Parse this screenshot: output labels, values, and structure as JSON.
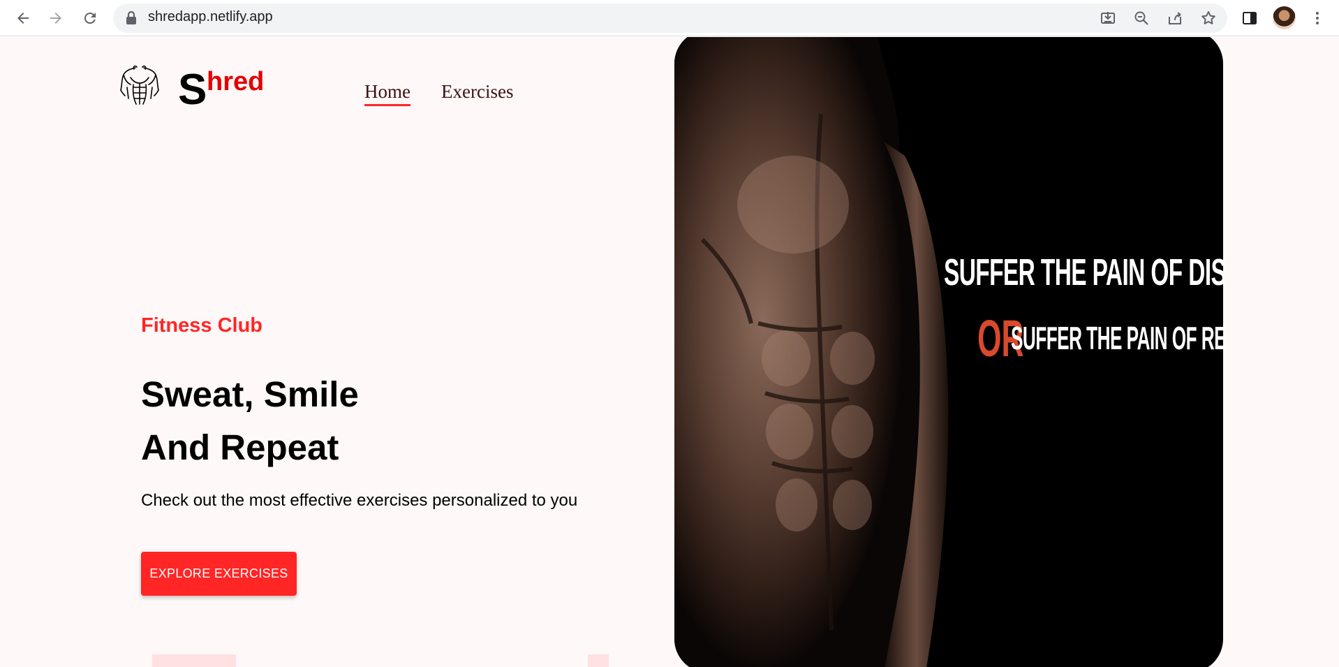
{
  "browser": {
    "url": "shredapp.netlify.app",
    "icons": [
      "back-icon",
      "forward-icon",
      "reload-icon",
      "lock-icon",
      "install-icon",
      "zoom-icon",
      "share-icon",
      "bookmark-star-icon",
      "side-panel-icon",
      "profile-avatar",
      "menu-dots-icon"
    ]
  },
  "header": {
    "brand_initial": "S",
    "brand_rest": "hred",
    "nav": [
      {
        "label": "Home",
        "active": true
      },
      {
        "label": "Exercises",
        "active": false
      }
    ]
  },
  "hero": {
    "eyebrow": "Fitness Club",
    "headline_line1": "Sweat, Smile",
    "headline_line2": "And Repeat",
    "subtext": "Check out the most effective exercises personalized to you",
    "cta_label": "EXPLORE EXERCISES"
  },
  "banner": {
    "quote_line1": "SUFFER THE PAIN OF DISCIPLINE",
    "quote_or": "OR",
    "quote_line2": "SUFFER THE PAIN OF REGRET"
  },
  "colors": {
    "accent": "#ff2625",
    "brand_red": "#e60000",
    "page_bg": "#fff8f8",
    "banner_bg": "#000000",
    "or_orange": "#d84a2b"
  }
}
